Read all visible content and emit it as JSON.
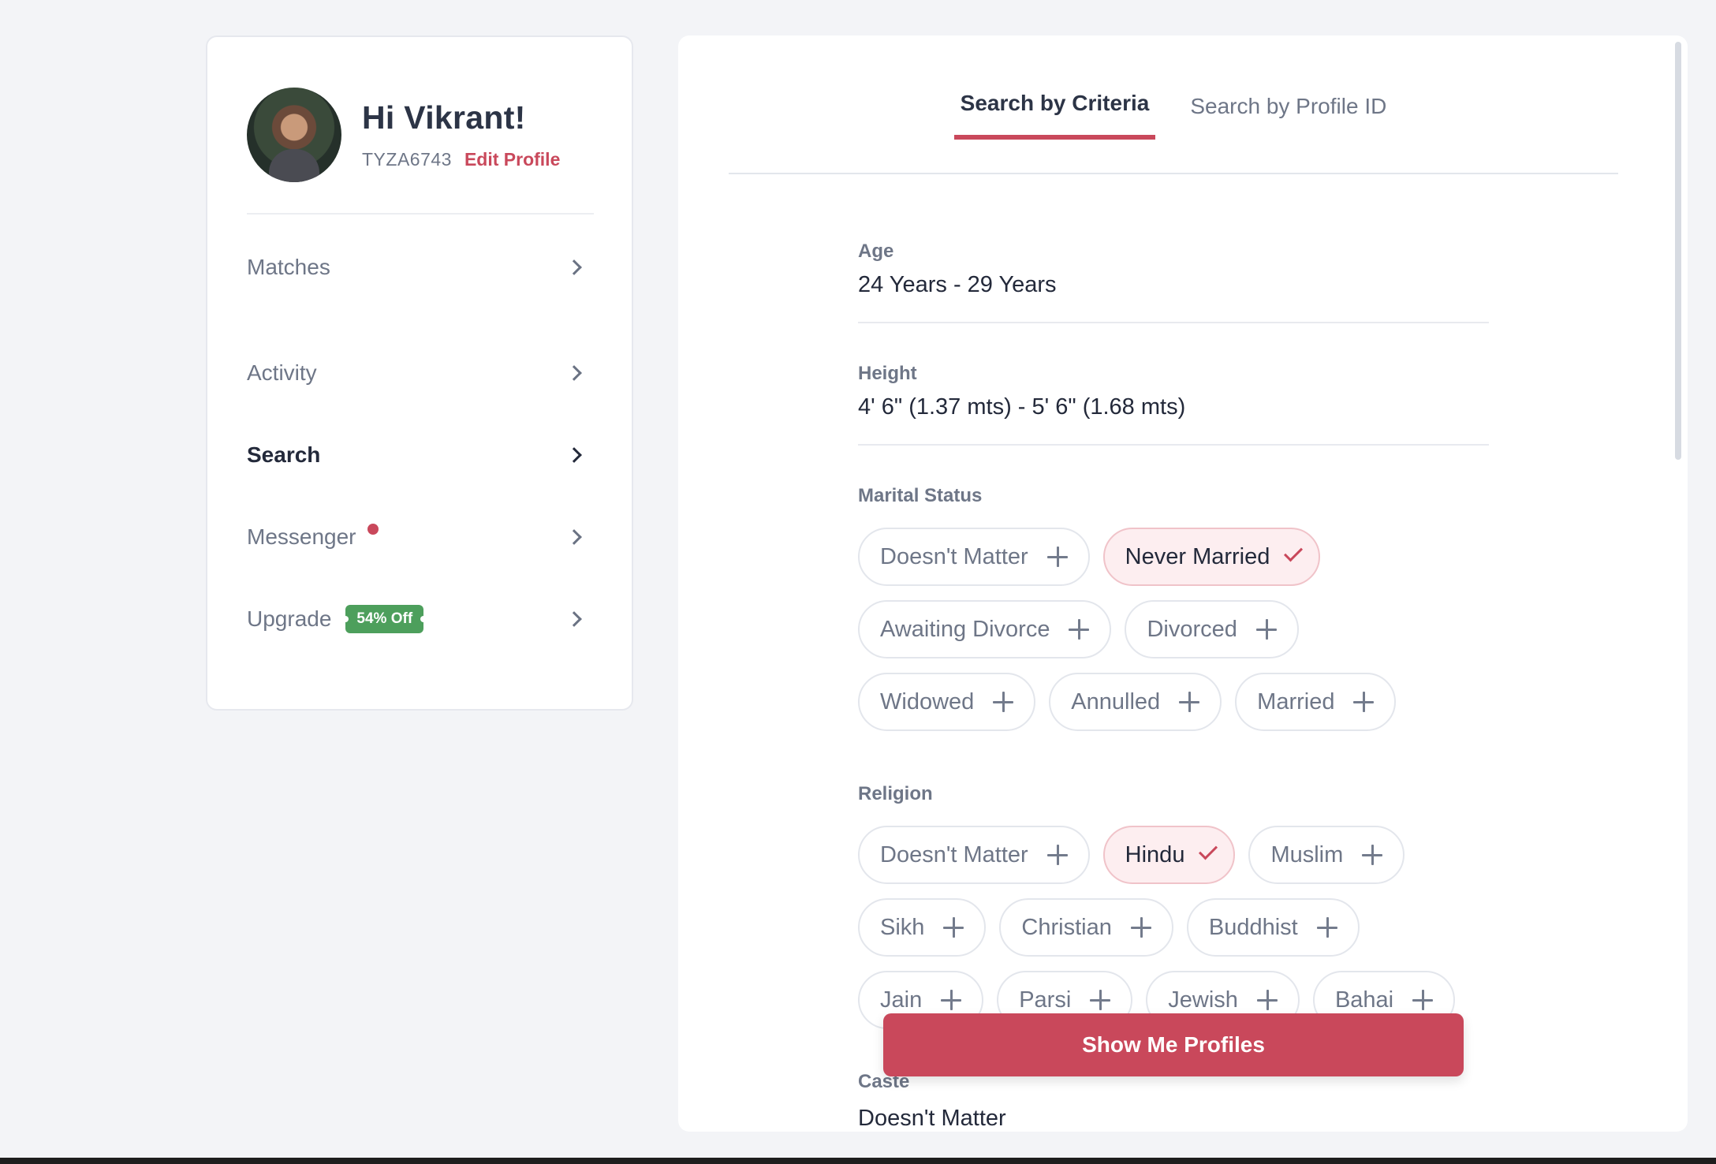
{
  "sidebar": {
    "greeting": "Hi Vikrant!",
    "profile_id": "TYZA6743",
    "edit_profile": "Edit Profile",
    "items": [
      {
        "label": "Matches"
      },
      {
        "label": "Activity"
      },
      {
        "label": "Search",
        "active": true
      },
      {
        "label": "Messenger",
        "notification_dot": true
      },
      {
        "label": "Upgrade",
        "badge": "54% Off"
      }
    ]
  },
  "tabs": [
    {
      "label": "Search by Criteria",
      "active": true
    },
    {
      "label": "Search by Profile ID"
    }
  ],
  "age": {
    "label": "Age",
    "value": "24 Years - 29 Years"
  },
  "height": {
    "label": "Height",
    "value": "4' 6\" (1.37 mts) - 5' 6\" (1.68 mts)"
  },
  "marital_status": {
    "label": "Marital Status",
    "options": [
      {
        "label": "Doesn't Matter"
      },
      {
        "label": "Never Married",
        "selected": true
      },
      {
        "label": "Awaiting Divorce"
      },
      {
        "label": "Divorced"
      },
      {
        "label": "Widowed"
      },
      {
        "label": "Annulled"
      },
      {
        "label": "Married"
      }
    ]
  },
  "religion": {
    "label": "Religion",
    "options": [
      {
        "label": "Doesn't Matter"
      },
      {
        "label": "Hindu",
        "selected": true
      },
      {
        "label": "Muslim"
      },
      {
        "label": "Sikh"
      },
      {
        "label": "Christian"
      },
      {
        "label": "Buddhist"
      },
      {
        "label": "Jain"
      },
      {
        "label": "Parsi"
      },
      {
        "label": "Jewish"
      },
      {
        "label": "Bahai"
      }
    ]
  },
  "caste": {
    "label": "Caste",
    "value": "Doesn't Matter"
  },
  "cta_label": "Show Me Profiles",
  "colors": {
    "accent": "#c9485b",
    "badge": "#4d9f5c",
    "selected_chip_bg": "#fdeef0"
  }
}
